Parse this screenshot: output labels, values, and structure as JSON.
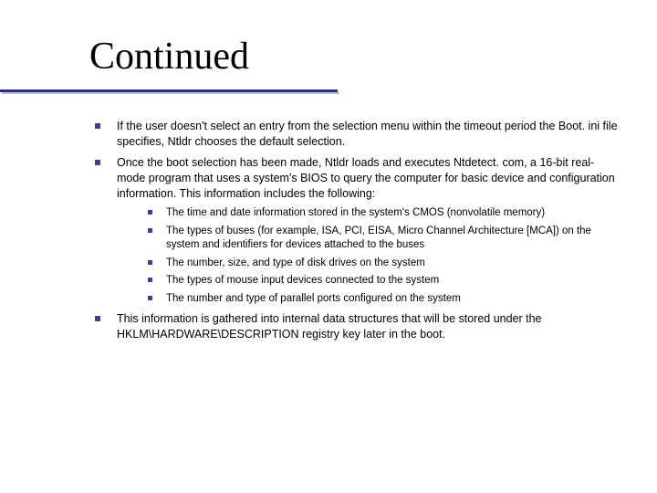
{
  "slide": {
    "title": "Continued",
    "bullets": [
      "If the user doesn't select an entry from the selection menu within the timeout period the Boot. ini file specifies, Ntldr chooses the default selection.",
      "Once the boot selection has been made, Ntldr loads and executes Ntdetect. com, a 16-bit real-mode program that uses a system's BIOS to query the computer for basic device and configuration information. This information includes the following:",
      "This information is gathered into internal data structures that will be stored under the HKLM\\HARDWARE\\DESCRIPTION registry key later in the boot."
    ],
    "subbullets": [
      "The time and date information stored in the system's CMOS (nonvolatile memory)",
      "The types of buses (for example, ISA, PCI, EISA, Micro Channel Architecture [MCA]) on the system and identifiers for devices attached to the buses",
      "The number, size, and type of disk drives on the system",
      "The types of mouse input devices connected to the system",
      "The number and type of parallel ports configured on the system"
    ]
  }
}
